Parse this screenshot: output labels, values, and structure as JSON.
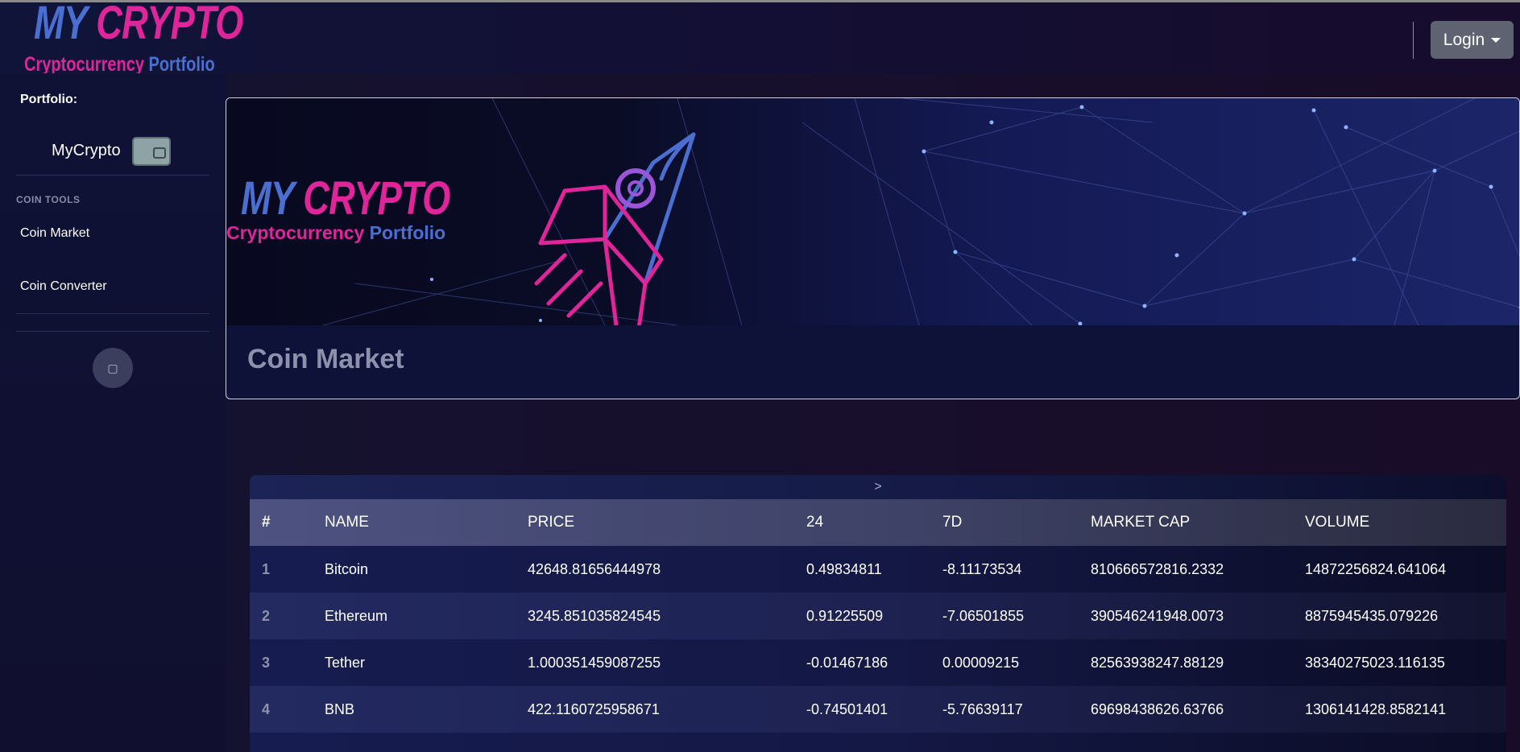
{
  "brand": {
    "logo_line1_a": "MY",
    "logo_line1_b": "CRYPTO",
    "logo_line2_a": "Cryptocurrency",
    "logo_line2_b": "Portfolio"
  },
  "header": {
    "login_label": "Login"
  },
  "sidebar": {
    "portfolio_label": "Portfolio:",
    "portfolio_name": "MyCrypto",
    "section_heading": "COIN TOOLS",
    "items": [
      {
        "label": "Coin Market"
      },
      {
        "label": "Coin Converter"
      }
    ],
    "toggle_icon": "toggle-icon"
  },
  "main": {
    "page_title": "Coin Market",
    "scroll_hint": ">",
    "table": {
      "headers": [
        "#",
        "NAME",
        "PRICE",
        "24",
        "7D",
        "MARKET CAP",
        "VOLUME"
      ],
      "rows": [
        {
          "rank": "1",
          "name": "Bitcoin",
          "price": "42648.81656444978",
          "h24": "0.49834811",
          "d7": "-8.11173534",
          "cap": "810666572816.2332",
          "volume": "14872256824.641064"
        },
        {
          "rank": "2",
          "name": "Ethereum",
          "price": "3245.851035824545",
          "h24": "0.91225509",
          "d7": "-7.06501855",
          "cap": "390546241948.0073",
          "volume": "8875945435.079226"
        },
        {
          "rank": "3",
          "name": "Tether",
          "price": "1.000351459087255",
          "h24": "-0.01467186",
          "d7": "0.00009215",
          "cap": "82563938247.88129",
          "volume": "38340275023.116135"
        },
        {
          "rank": "4",
          "name": "BNB",
          "price": "422.1160725958671",
          "h24": "-0.74501401",
          "d7": "-5.76639117",
          "cap": "69698438626.63766",
          "volume": "1306141428.8582141"
        }
      ]
    }
  },
  "colors": {
    "accent_pink": "#e0249a",
    "accent_blue": "#4a6fd0",
    "background": "#14102e"
  }
}
